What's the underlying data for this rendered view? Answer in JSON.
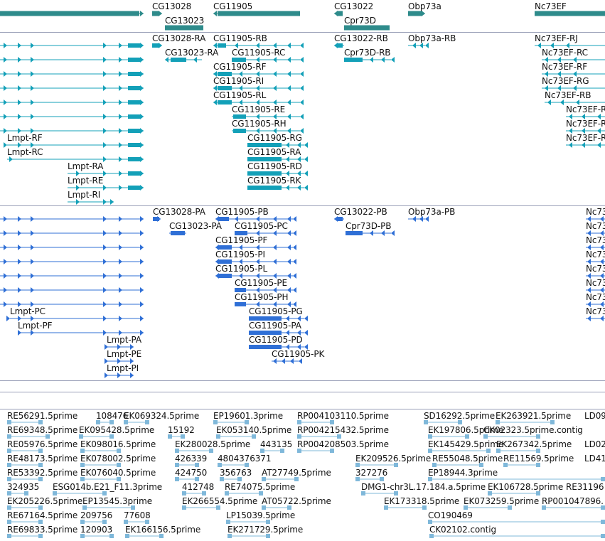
{
  "colors": {
    "gene": "#2e8b8b",
    "rna": "#13a0b8",
    "protein": "#2f6fd6",
    "est": "#7fb8da",
    "separator": "#9aa0b8"
  },
  "gene_track": {
    "labels": [
      "CG13028",
      "CG13023",
      "CG11905",
      "CG13022",
      "Cpr73D",
      "Obp73a",
      "Nc73EF"
    ]
  },
  "transcript_track": {
    "labels": [
      "CG13028-RA",
      "CG11905-RB",
      "CG13022-RB",
      "Obp73a-RB",
      "Nc73EF-RJ",
      "CG13023-RA",
      "CG11905-RC",
      "Cpr73D-RB",
      "Nc73EF-RC",
      "CG11905-RF",
      "Nc73EF-RF",
      "CG11905-RI",
      "Nc73EF-RG",
      "CG11905-RL",
      "Nc73EF-RB",
      "CG11905-RE",
      "Nc73EF-R",
      "CG11905-RH",
      "Nc73EF-R",
      "Lmpt-RF",
      "CG11905-RG",
      "Nc73EF-R",
      "Lmpt-RC",
      "CG11905-RA",
      "Lmpt-RA",
      "CG11905-RD",
      "Lmpt-RE",
      "CG11905-RK",
      "Lmpt-RI"
    ]
  },
  "protein_track": {
    "labels": [
      "CG13028-PA",
      "CG11905-PB",
      "CG13022-PB",
      "Obp73a-PB",
      "Nc73",
      "CG13023-PA",
      "CG11905-PC",
      "Cpr73D-PB",
      "Nc73",
      "CG11905-PF",
      "Nc73",
      "CG11905-PI",
      "Nc73",
      "CG11905-PL",
      "Nc73",
      "CG11905-PE",
      "Nc73",
      "CG11905-PH",
      "Nc73",
      "Lmpt-PC",
      "CG11905-PG",
      "Nc73",
      "Lmpt-PF",
      "CG11905-PA",
      "Lmpt-PA",
      "CG11905-PD",
      "Lmpt-PE",
      "CG11905-PK",
      "Lmpt-PI"
    ]
  },
  "est_track": {
    "labels": [
      "RE56291.5prime",
      "108476",
      "EK069324.5prime",
      "EP19601.3prime",
      "RP004103110.5prime",
      "SD16292.5prime",
      "EK263921.5prime",
      "LD09",
      "RE69348.5prime",
      "EK095428.5prime",
      "15192",
      "EK053140.5prime",
      "RP004215432.5prime",
      "EK197806.5prime",
      "CK02323.5prime.contig",
      "RE05976.5prime",
      "EK098016.5prime",
      "EK280028.5prime",
      "443135",
      "RP004208503.5prime",
      "EK145429.5prime",
      "EK267342.5prime",
      "LD02",
      "RE48173.5prime",
      "EK078002.5prime",
      "426339",
      "4804376371",
      "EK209526.5prime",
      "RE55048.5prime",
      "RE11569.5prime",
      "LD41",
      "RE53392.5prime",
      "EK076040.5prime",
      "424750",
      "356763",
      "AT27749.5prime",
      "327276",
      "EP18944.3prime",
      "324935",
      "ESG014b.E21_F11.3prime",
      "412748",
      "RE74075.5prime",
      "DMG1-chr3L.17.184.a.5prime",
      "EK106728.5prime",
      "RE31196",
      "EK205226.5prime",
      "EP13545.3prime",
      "EK266554.5prime",
      "AT05722.5prime",
      "EK173318.5prime",
      "EK073259.5prime",
      "RP001047896.",
      "RE67164.5prime",
      "209756",
      "77608",
      "LP15039.5prime",
      "CO190469",
      "RE69833.5prime",
      "120903",
      "EK166156.5prime",
      "EK271729.5prime",
      "CK02102.contig"
    ]
  }
}
